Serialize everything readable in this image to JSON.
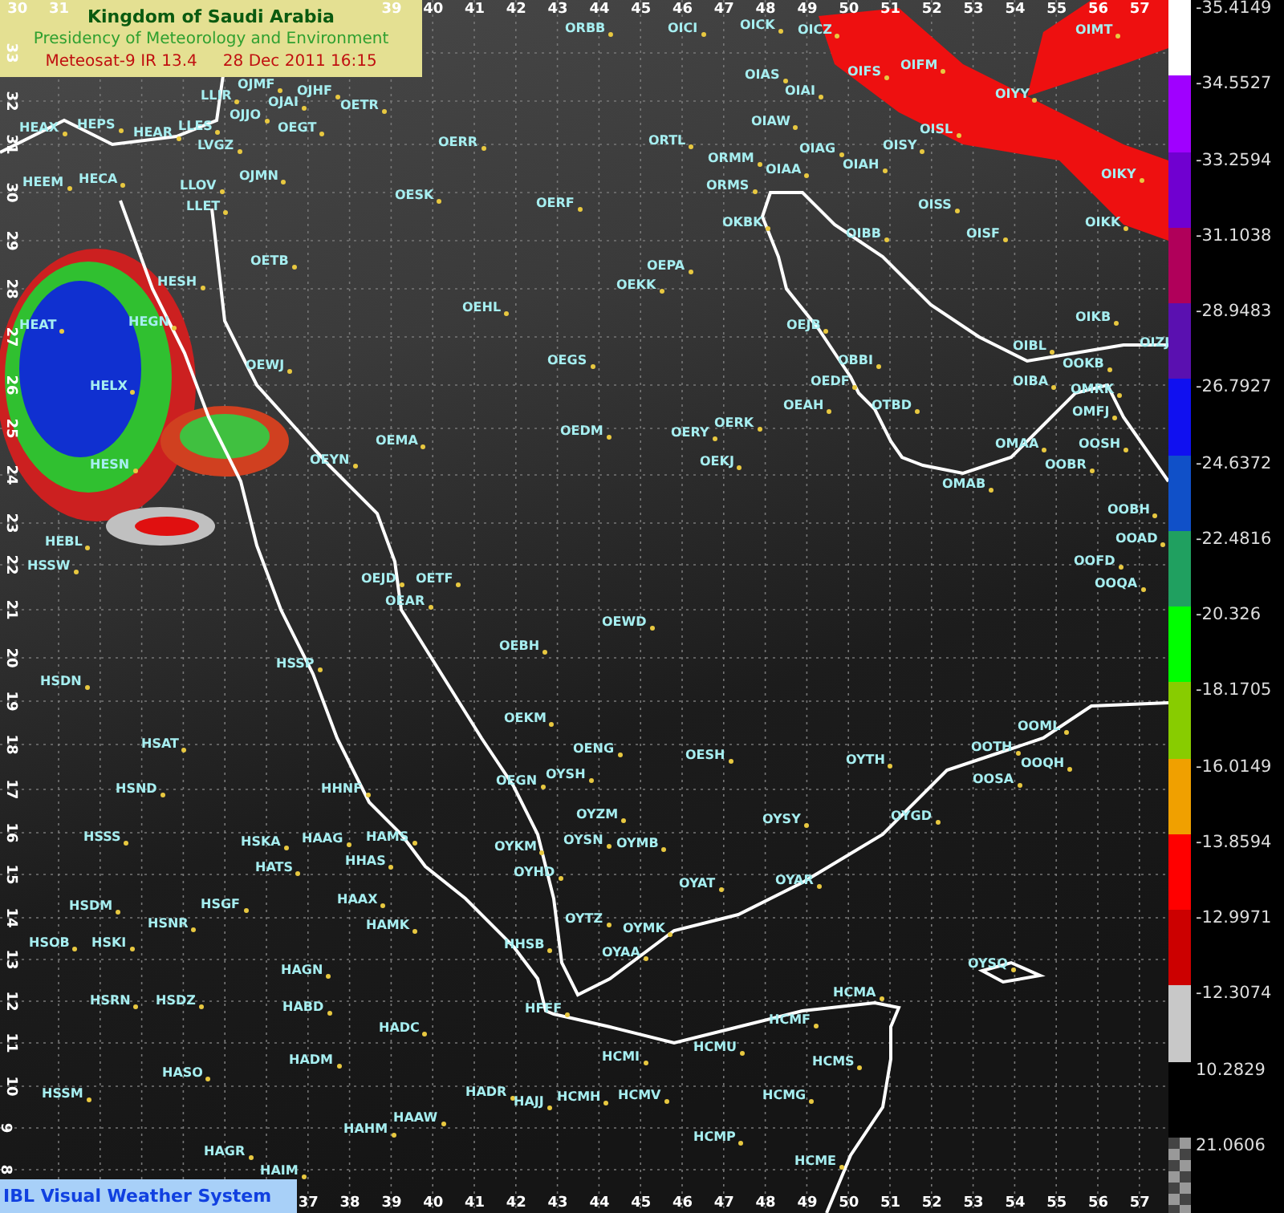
{
  "header": {
    "title": "Kingdom of Saudi Arabia",
    "subtitle": "Presidency of Meteorology and Environment",
    "product": "Meteosat-9 IR 13.4",
    "datetime": "28 Dec 2011 16:15"
  },
  "top_ticks": [
    "30",
    "31",
    "39",
    "40",
    "41",
    "42",
    "43",
    "44",
    "45",
    "46",
    "47",
    "48",
    "49",
    "50",
    "51",
    "52",
    "53",
    "54",
    "55",
    "56",
    "57"
  ],
  "bottom_ticks": [
    "37",
    "38",
    "39",
    "40",
    "41",
    "42",
    "43",
    "44",
    "45",
    "46",
    "47",
    "48",
    "49",
    "50",
    "51",
    "52",
    "53",
    "54",
    "55",
    "56",
    "57"
  ],
  "lat_ticks": [
    "33",
    "32",
    "31",
    "30",
    "29",
    "28",
    "27",
    "26",
    "25",
    "24",
    "23",
    "22",
    "21",
    "20",
    "19",
    "18",
    "17",
    "16",
    "15",
    "14",
    "13",
    "12",
    "11",
    "10",
    "9",
    "8"
  ],
  "stations": [
    "ORBB",
    "OICI",
    "OICK",
    "OICZ",
    "OIMT",
    "LLIR",
    "OJMF",
    "OJAI",
    "OJHF",
    "OETR",
    "HEAX",
    "HEPS",
    "HEAR",
    "LLES",
    "LVGZ",
    "OJJO",
    "OEGT",
    "OERR",
    "HEEM",
    "HECA",
    "LLOV",
    "LLET",
    "OJMN",
    "OESK",
    "OERF",
    "OETB",
    "HESH",
    "HEAT",
    "HEGN",
    "OEHL",
    "OEWJ",
    "OEGS",
    "HELX",
    "OIAS",
    "OIAI",
    "OIFS",
    "OIFM",
    "OIYY",
    "ORTL",
    "OIAW",
    "OISL",
    "ORMM",
    "ORMS",
    "OIAG",
    "OISY",
    "OIAA",
    "OIAH",
    "OIKY",
    "OISS",
    "OKBK",
    "OIBB",
    "OISF",
    "OIKK",
    "OEPA",
    "OEKK",
    "OEJB",
    "OIKB",
    "OIBL",
    "OIZJ",
    "OBBI",
    "OOKB",
    "OEDF",
    "OIBA",
    "OMRK",
    "OEAH",
    "OTBD",
    "OERK",
    "OMFJ",
    "OERY",
    "OMAA",
    "OOSH",
    "OEKJ",
    "OOBR",
    "OMAB",
    "OOBH",
    "OOAD",
    "OOFD",
    "OOQA",
    "OEMA",
    "OEDM",
    "HESN",
    "OEYN",
    "HEBL",
    "HSSW",
    "OEJD",
    "OETF",
    "OEAR",
    "OEWD",
    "OEBH",
    "HSSP",
    "HSDN",
    "OEKM",
    "HSAT",
    "OENG",
    "HSND",
    "HHNF",
    "OEGN",
    "OYSH",
    "OESH",
    "OYTH",
    "OOML",
    "OOTH",
    "OOQH",
    "OOSA",
    "OYZM",
    "HSSS",
    "HSKA",
    "HAAG",
    "HAMS",
    "OYKM",
    "OYSN",
    "OYMB",
    "HATS",
    "HHAS",
    "OYHD",
    "HSDM",
    "HSNR",
    "HSGF",
    "HAAX",
    "HAMK",
    "OYTZ",
    "OYMK",
    "HSOB",
    "HSKI",
    "HHSB",
    "OYAA",
    "HAGN",
    "HSRN",
    "HSDZ",
    "HABD",
    "HFFF",
    "HADC",
    "HADM",
    "HCMI",
    "HASO",
    "HSSM",
    "HADR",
    "HAJJ",
    "HCMH",
    "HCMV",
    "HAHM",
    "HAAW",
    "HAGR",
    "HAIM",
    "OYSY",
    "OYGD",
    "OYAT",
    "OYAR",
    "OYSQ",
    "HCMA",
    "HCMF",
    "HCMU",
    "HCMS",
    "HCMG",
    "HCMP",
    "HCME"
  ],
  "legend": [
    {
      "value": "-35.4149",
      "color": "#ffffff",
      "kind": "solid"
    },
    {
      "value": "-34.5527",
      "color": "#a000ff",
      "kind": "solid"
    },
    {
      "value": "-33.2594",
      "color": "#7000d0",
      "kind": "solid"
    },
    {
      "value": "-31.1038",
      "color": "#b0005a",
      "kind": "solid"
    },
    {
      "value": "-28.9483",
      "color": "#5a10b0",
      "kind": "solid"
    },
    {
      "value": "-26.7927",
      "color": "#1010f0",
      "kind": "solid"
    },
    {
      "value": "-24.6372",
      "color": "#1050c8",
      "kind": "solid"
    },
    {
      "value": "-22.4816",
      "color": "#20a060",
      "kind": "solid"
    },
    {
      "value": "-20.326",
      "color": "#00ff00",
      "kind": "solid"
    },
    {
      "value": "-18.1705",
      "color": "#88cc00",
      "kind": "solid"
    },
    {
      "value": "-16.0149",
      "color": "#f0a000",
      "kind": "solid"
    },
    {
      "value": "-13.8594",
      "color": "#ff0000",
      "kind": "solid"
    },
    {
      "value": "-12.9971",
      "color": "#cc0000",
      "kind": "solid"
    },
    {
      "value": "-12.3074",
      "color": "#c8c8c8",
      "kind": "solid"
    },
    {
      "value": "10.2829",
      "color": "#000000",
      "kind": "solid"
    },
    {
      "value": "21.0606",
      "color": "#444444",
      "kind": "checker"
    }
  ],
  "footer": "IBL Visual Weather System"
}
